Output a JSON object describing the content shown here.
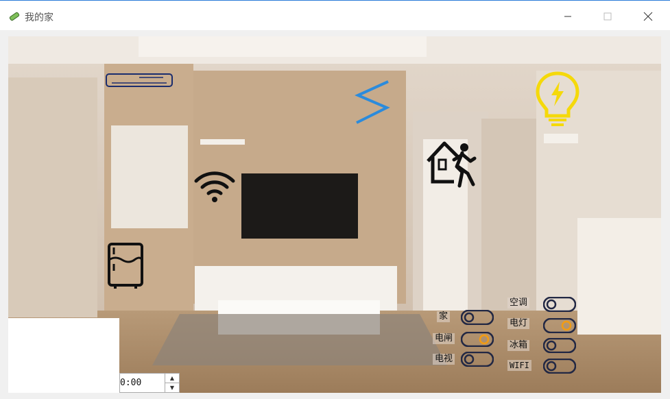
{
  "window": {
    "title": "我的家"
  },
  "time_input": {
    "value": "0:00",
    "up_icon": "spin-up-icon",
    "down_icon": "spin-down-icon"
  },
  "controls": [
    {
      "id": "home",
      "label": "家",
      "on": false
    },
    {
      "id": "breaker",
      "label": "电闸",
      "on": true
    },
    {
      "id": "tv",
      "label": "电视",
      "on": false
    },
    {
      "id": "ac",
      "label": "空调",
      "on": false
    },
    {
      "id": "light",
      "label": "电灯",
      "on": true
    },
    {
      "id": "fridge",
      "label": "冰箱",
      "on": false
    },
    {
      "id": "wifi",
      "label": "WIFI",
      "on": false
    }
  ],
  "colors": {
    "toggle_on": "#f39c12",
    "toggle_off": "#222844",
    "lightning": "#2b8bdc",
    "bulb": "#f5d90a"
  },
  "icons": [
    "app-icon",
    "minimize-icon",
    "maximize-icon",
    "close-icon",
    "air-conditioner-icon",
    "wifi-icon",
    "fridge-icon",
    "lightning-icon",
    "home-exit-icon",
    "light-bulb-icon"
  ]
}
